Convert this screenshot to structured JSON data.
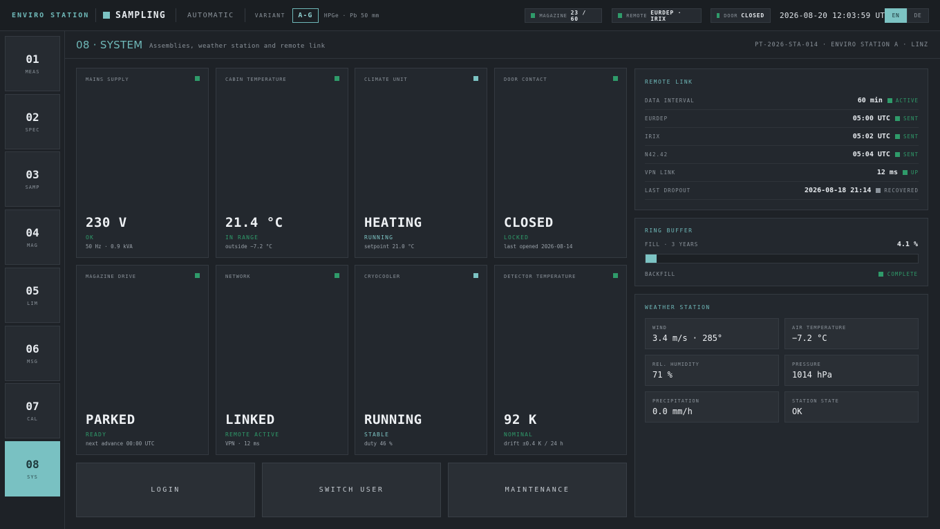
{
  "topbar": {
    "brand": "ENVIRO STATION",
    "mode": "SAMPLING",
    "automatic": "AUTOMATIC",
    "variant_label": "VARIANT",
    "variant_value": "A-G",
    "detector": "HPGe · Pb 50 mm",
    "magazine_label": "MAGAZINE",
    "magazine_value": "23 / 60",
    "remote_label": "REMOTE",
    "remote_value": "EURDEP · IRIX",
    "door_label": "DOOR",
    "door_value": "CLOSED",
    "clock": "2026-08-20 12:03:59 UTC",
    "lang_en": "EN",
    "lang_de": "DE"
  },
  "nav": [
    {
      "num": "01",
      "label": "MEAS"
    },
    {
      "num": "02",
      "label": "SPEC"
    },
    {
      "num": "03",
      "label": "SAMP"
    },
    {
      "num": "04",
      "label": "MAG"
    },
    {
      "num": "05",
      "label": "LIM"
    },
    {
      "num": "06",
      "label": "MSG"
    },
    {
      "num": "07",
      "label": "CAL"
    },
    {
      "num": "08",
      "label": "SYS"
    }
  ],
  "page": {
    "title": "08 · SYSTEM",
    "subtitle": "Assemblies, weather station and remote link",
    "id": "PT-2026-STA-014 · ENVIRO STATION A · LINZ"
  },
  "tiles": [
    {
      "caption": "MAINS SUPPLY",
      "value": "230 V",
      "status": "OK",
      "detail": "50 Hz · 0.9 kVA"
    },
    {
      "caption": "CABIN TEMPERATURE",
      "value": "21.4 °C",
      "status": "IN RANGE",
      "detail": "outside −7.2 °C"
    },
    {
      "caption": "CLIMATE UNIT",
      "value": "HEATING",
      "status": "RUNNING",
      "detail": "setpoint 21.0 °C"
    },
    {
      "caption": "DOOR CONTACT",
      "value": "CLOSED",
      "status": "LOCKED",
      "detail": "last opened 2026-08-14"
    },
    {
      "caption": "MAGAZINE DRIVE",
      "value": "PARKED",
      "status": "READY",
      "detail": "next advance 00:00 UTC"
    },
    {
      "caption": "NETWORK",
      "value": "LINKED",
      "status": "REMOTE ACTIVE",
      "detail": "VPN · 12 ms"
    },
    {
      "caption": "CRYOCOOLER",
      "value": "RUNNING",
      "status": "STABLE",
      "detail": "duty 46 %"
    },
    {
      "caption": "DETECTOR TEMPERATURE",
      "value": "92 K",
      "status": "NOMINAL",
      "detail": "drift ±0.4 K / 24 h"
    }
  ],
  "actions": {
    "login": "LOGIN",
    "switch_user": "SWITCH USER",
    "maintenance": "MAINTENANCE"
  },
  "remote_link": {
    "title": "REMOTE LINK",
    "rows": [
      {
        "key": "DATA INTERVAL",
        "value": "60 min",
        "status": "ACTIVE"
      },
      {
        "key": "EURDEP",
        "value": "05:00 UTC",
        "status": "SENT"
      },
      {
        "key": "IRIX",
        "value": "05:02 UTC",
        "status": "SENT"
      },
      {
        "key": "N42.42",
        "value": "05:04 UTC",
        "status": "SENT"
      },
      {
        "key": "VPN LINK",
        "value": "12 ms",
        "status": "UP"
      },
      {
        "key": "LAST DROPOUT",
        "value": "2026-08-18 21:14",
        "status": "RECOVERED"
      }
    ]
  },
  "ring_buffer": {
    "title": "RING BUFFER",
    "fill_label": "FILL · 3 YEARS",
    "fill_value": "4.1 %",
    "fill_percent": 4.1,
    "backfill_label": "BACKFILL",
    "backfill_status": "COMPLETE"
  },
  "weather": {
    "title": "WEATHER STATION",
    "cells": [
      {
        "key": "WIND",
        "value": "3.4 m/s · 285°"
      },
      {
        "key": "AIR TEMPERATURE",
        "value": "−7.2 °C"
      },
      {
        "key": "REL. HUMIDITY",
        "value": "71 %"
      },
      {
        "key": "PRESSURE",
        "value": "1014 hPa"
      },
      {
        "key": "PRECIPITATION",
        "value": "0.0 mm/h"
      },
      {
        "key": "STATION STATE",
        "value": "OK"
      }
    ]
  },
  "colors": {
    "accent": "#7cc3c3",
    "ok": "#2f9b6a",
    "muted": "#8b939b"
  }
}
